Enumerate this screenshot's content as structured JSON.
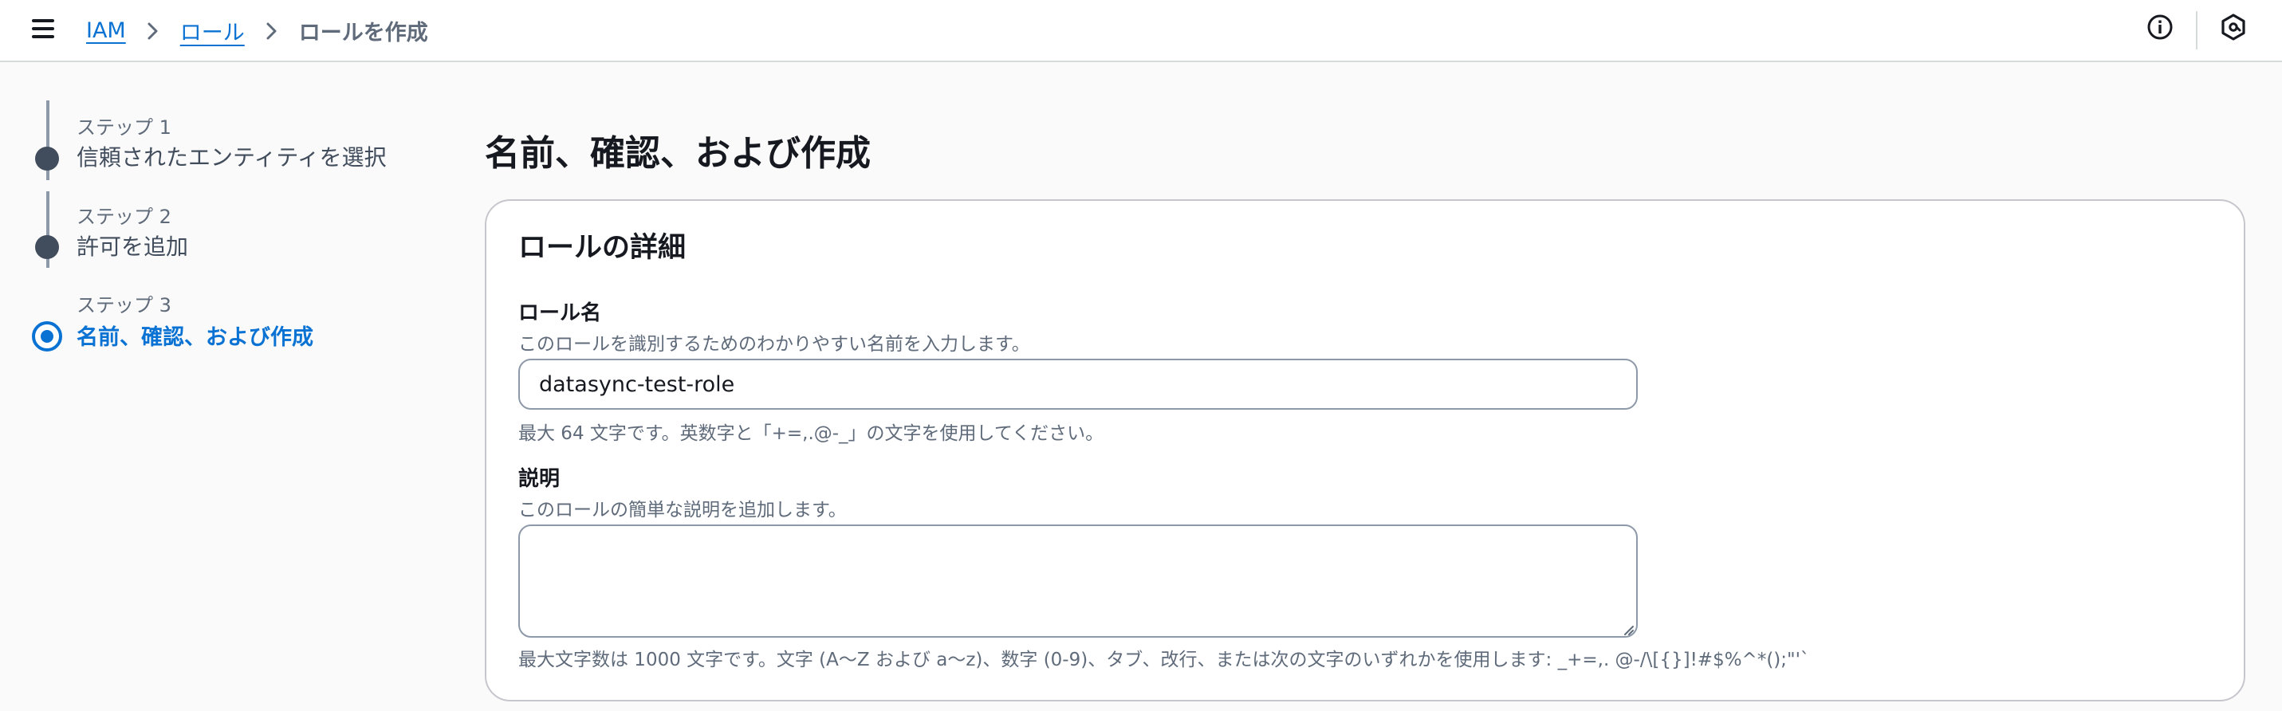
{
  "breadcrumb": {
    "items": [
      "IAM",
      "ロール"
    ],
    "current": "ロールを作成"
  },
  "icons": {
    "menu": "hamburger-menu-icon",
    "info": "info-circle-icon",
    "profile": "hexagon-badge-icon",
    "separator": "chevron-right-icon"
  },
  "steps": [
    {
      "number": "ステップ 1",
      "title": "信頼されたエンティティを選択",
      "state": "completed"
    },
    {
      "number": "ステップ 2",
      "title": "許可を追加",
      "state": "completed"
    },
    {
      "number": "ステップ 3",
      "title": "名前、確認、および作成",
      "state": "active"
    }
  ],
  "page": {
    "title": "名前、確認、および作成"
  },
  "role_details": {
    "heading": "ロールの詳細",
    "role_name": {
      "label": "ロール名",
      "description": "このロールを識別するためのわかりやすい名前を入力します。",
      "value": "datasync-test-role",
      "constraint": "最大 64 文字です。英数字と「+=,.@-_」の文字を使用してください。"
    },
    "description_field": {
      "label": "説明",
      "description": "このロールの簡単な説明を追加します。",
      "value": "",
      "constraint": "最大文字数は 1000 文字です。文字 (A〜Z および a〜z)、数字 (0-9)、タブ、改行、または次の文字のいずれかを使用します: _+=,. @-/\\[{}]!#$%^*();\"'`"
    }
  },
  "colors": {
    "accent": "#0972d3",
    "completed_dot": "#414d5c",
    "text": "#16191f",
    "muted": "#5f6b7a"
  }
}
